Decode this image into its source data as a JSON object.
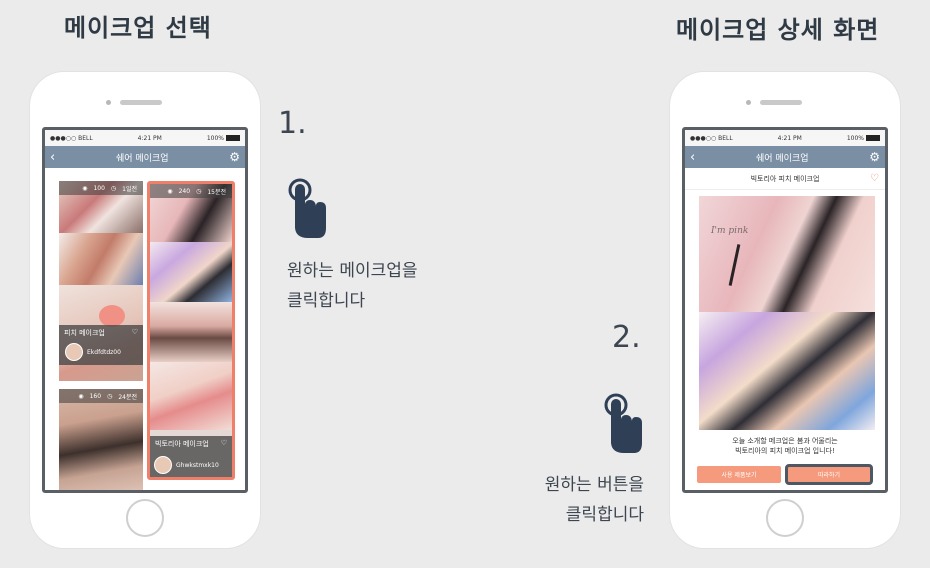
{
  "left_heading": "메이크업 선택",
  "right_heading": "메이크업 상세 화면",
  "status": {
    "carrier": "●●●○○ BELL",
    "time": "4:21 PM",
    "battery": "100%"
  },
  "left_phone": {
    "nav_title": "쉐어 메이크업",
    "card1": {
      "views": "100",
      "time": "1일전"
    },
    "card2": {
      "views": "240",
      "time": "15분전",
      "title": "빅토리아 메이크업",
      "user": "Ghwkstmxk10"
    },
    "card3": {
      "title": "피치 메이크업",
      "user": "Ekdfdtdz00"
    },
    "card4": {
      "views": "160",
      "time": "24분전"
    }
  },
  "right_phone": {
    "nav_title": "쉐어 메이크업",
    "detail_title": "빅토리아 피치 메이크업",
    "description_line1": "오늘 소개할 메크업은 봄과 어울리는",
    "description_line2": "빅토리아의 피치 메이크업 입니다!",
    "button_use": "사용 제품보기",
    "button_follow": "따라하기",
    "poster_script": "I'm pink"
  },
  "steps": {
    "step1_number": "1.",
    "step1_line1": "원하는 메이크업을",
    "step1_line2": "클릭합니다",
    "step2_number": "2.",
    "step2_line1": "원하는 버튼을",
    "step2_line2": "클릭합니다"
  },
  "colors": {
    "nav": "#7b8fa4",
    "highlight": "#f07f6a",
    "button": "#f59a7d"
  }
}
